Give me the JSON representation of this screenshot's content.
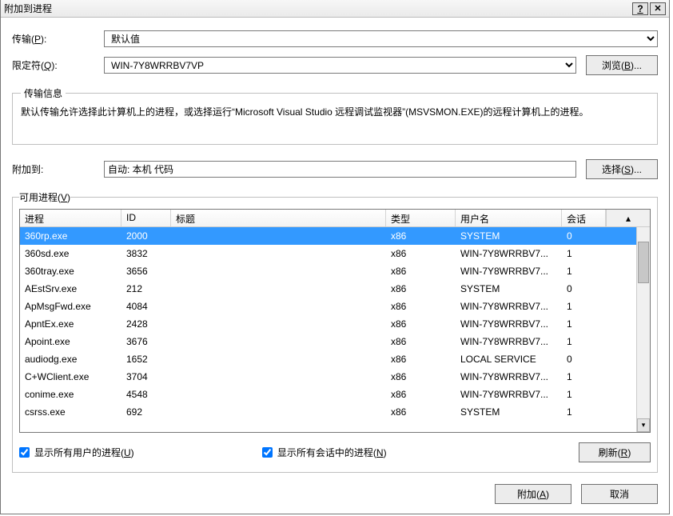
{
  "window": {
    "title": "附加到进程"
  },
  "transport": {
    "label": "传输(P):",
    "value": "默认值"
  },
  "qualifier": {
    "label": "限定符(Q):",
    "value": "WIN-7Y8WRRBV7VP",
    "browse": "浏览(B)..."
  },
  "info": {
    "legend": "传输信息",
    "text": "默认传输允许选择此计算机上的进程，或选择运行“Microsoft Visual Studio 远程调试监视器”(MSVSMON.EXE)的远程计算机上的进程。"
  },
  "attach_to": {
    "label": "附加到:",
    "value": "自动: 本机 代码",
    "select": "选择(S)..."
  },
  "available": {
    "legend": "可用进程(V)",
    "cols": {
      "proc": "进程",
      "id": "ID",
      "title_": "标题",
      "type": "类型",
      "user": "用户名",
      "session": "会话"
    }
  },
  "processes": [
    {
      "proc": "360rp.exe",
      "id": "2000",
      "title_": "",
      "type": "x86",
      "user": "SYSTEM",
      "session": "0",
      "selected": true
    },
    {
      "proc": "360sd.exe",
      "id": "3832",
      "title_": "",
      "type": "x86",
      "user": "WIN-7Y8WRRBV7...",
      "session": "1"
    },
    {
      "proc": "360tray.exe",
      "id": "3656",
      "title_": "",
      "type": "x86",
      "user": "WIN-7Y8WRRBV7...",
      "session": "1"
    },
    {
      "proc": "AEstSrv.exe",
      "id": "212",
      "title_": "",
      "type": "x86",
      "user": "SYSTEM",
      "session": "0"
    },
    {
      "proc": "ApMsgFwd.exe",
      "id": "4084",
      "title_": "",
      "type": "x86",
      "user": "WIN-7Y8WRRBV7...",
      "session": "1"
    },
    {
      "proc": "ApntEx.exe",
      "id": "2428",
      "title_": "",
      "type": "x86",
      "user": "WIN-7Y8WRRBV7...",
      "session": "1"
    },
    {
      "proc": "Apoint.exe",
      "id": "3676",
      "title_": "",
      "type": "x86",
      "user": "WIN-7Y8WRRBV7...",
      "session": "1"
    },
    {
      "proc": "audiodg.exe",
      "id": "1652",
      "title_": "",
      "type": "x86",
      "user": "LOCAL SERVICE",
      "session": "0"
    },
    {
      "proc": "C+WClient.exe",
      "id": "3704",
      "title_": "",
      "type": "x86",
      "user": "WIN-7Y8WRRBV7...",
      "session": "1"
    },
    {
      "proc": "conime.exe",
      "id": "4548",
      "title_": "",
      "type": "x86",
      "user": "WIN-7Y8WRRBV7...",
      "session": "1"
    },
    {
      "proc": "csrss.exe",
      "id": "692",
      "title_": "",
      "type": "x86",
      "user": "SYSTEM",
      "session": "1"
    }
  ],
  "show_all_users": "显示所有用户的进程(U)",
  "show_all_sessions": "显示所有会话中的进程(N)",
  "refresh": "刷新(R)",
  "attach_btn": "附加(A)",
  "cancel_btn": "取消"
}
